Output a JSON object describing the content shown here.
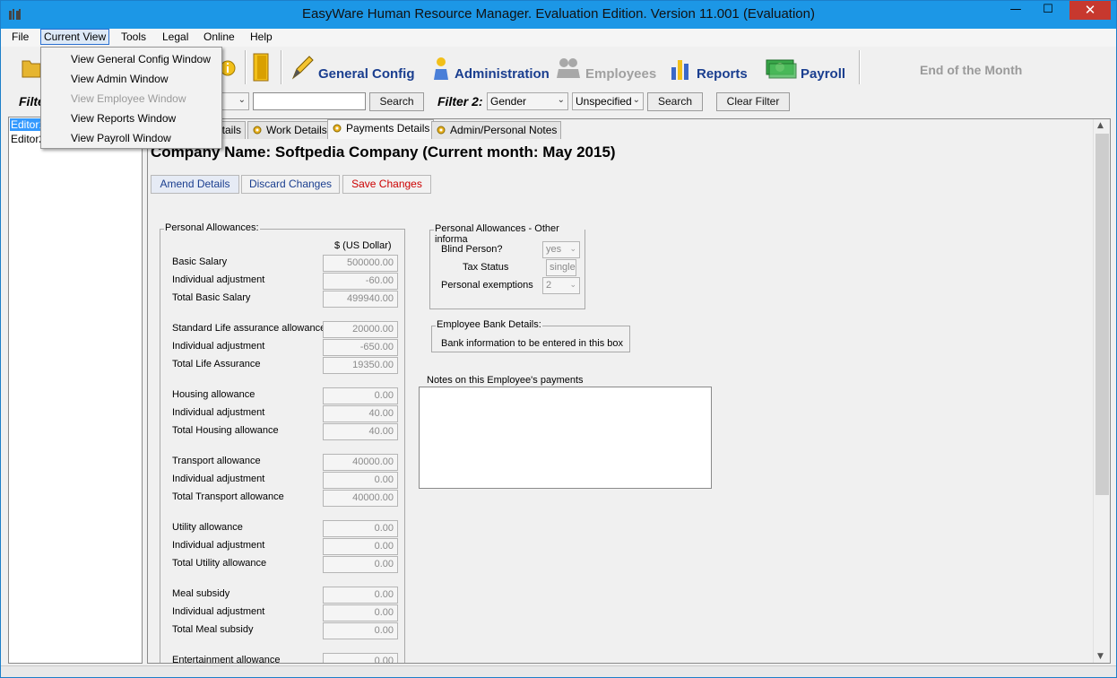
{
  "window": {
    "title": "EasyWare Human Resource Manager. Evaluation Edition. Version 11.001 (Evaluation)",
    "minimize": "—",
    "maximize": "☐",
    "close": "✕"
  },
  "menu": {
    "file": "File",
    "current_view": "Current View",
    "tools": "Tools",
    "legal": "Legal",
    "online": "Online",
    "help": "Help"
  },
  "current_view_menu": [
    {
      "label": "View General Config Window",
      "enabled": true
    },
    {
      "label": "View Admin Window",
      "enabled": true
    },
    {
      "label": "View Employee Window",
      "enabled": false
    },
    {
      "label": "View Reports Window",
      "enabled": true
    },
    {
      "label": "View Payroll Window",
      "enabled": true
    }
  ],
  "toolbar": {
    "general_config": "General Config",
    "administration": "Administration",
    "employees": "Employees",
    "reports": "Reports",
    "payroll": "Payroll",
    "end_of_month": "End of the Month"
  },
  "filter": {
    "filter1_label": "Filte",
    "filter1_search": "Search",
    "filter2_label": "Filter 2:",
    "filter2_field": "Gender",
    "filter2_value": "Unspecified",
    "filter2_search": "Search",
    "clear_filter": "Clear Filter"
  },
  "employees_list": [
    "Editor1",
    "Editor2"
  ],
  "tabs": [
    {
      "label": "etails"
    },
    {
      "label": "Work Details"
    },
    {
      "label": "Payments Details"
    },
    {
      "label": "Admin/Personal Notes"
    }
  ],
  "company": {
    "heading": "Company Name: Softpedia Company  (Current month: May  2015)"
  },
  "actions": {
    "amend": "Amend Details",
    "discard": "Discard Changes",
    "save": "Save Changes"
  },
  "allowances": {
    "group_title": "Personal Allowances:",
    "currency_header": "$ (US Dollar)",
    "rows": [
      {
        "label": "Basic Salary",
        "value": "500000.00"
      },
      {
        "label": "Individual adjustment",
        "value": "-60.00"
      },
      {
        "label": "Total Basic Salary",
        "value": "499940.00"
      },
      {
        "label": "Standard Life assurance allowance",
        "value": "20000.00"
      },
      {
        "label": "Individual adjustment",
        "value": "-650.00"
      },
      {
        "label": "Total Life Assurance",
        "value": "19350.00"
      },
      {
        "label": "Housing allowance",
        "value": "0.00"
      },
      {
        "label": "Individual adjustment",
        "value": "40.00"
      },
      {
        "label": "Total Housing allowance",
        "value": "40.00"
      },
      {
        "label": "Transport allowance",
        "value": "40000.00"
      },
      {
        "label": "Individual adjustment",
        "value": "0.00"
      },
      {
        "label": "Total Transport allowance",
        "value": "40000.00"
      },
      {
        "label": "Utility allowance",
        "value": "0.00"
      },
      {
        "label": "Individual adjustment",
        "value": "0.00"
      },
      {
        "label": "Total Utility allowance",
        "value": "0.00"
      },
      {
        "label": "Meal subsidy",
        "value": "0.00"
      },
      {
        "label": "Individual adjustment",
        "value": "0.00"
      },
      {
        "label": "Total Meal subsidy",
        "value": "0.00"
      },
      {
        "label": "Entertainment allowance",
        "value": "0.00"
      }
    ]
  },
  "other_info": {
    "group_title": "Personal Allowances - Other informa",
    "blind_label": "Blind Person?",
    "blind_value": "yes",
    "tax_label": "Tax Status",
    "tax_value": "single",
    "exemptions_label": "Personal exemptions",
    "exemptions_value": "2"
  },
  "bank": {
    "group_title": "Employee Bank Details:",
    "text": "Bank information to be entered in this box"
  },
  "notes": {
    "label": "Notes on this Employee's payments",
    "value": ""
  },
  "colors": {
    "titlebar": "#1c97e6",
    "accent": "#1a3e8f",
    "save_text": "#cc0000",
    "selection": "#3399ff"
  }
}
